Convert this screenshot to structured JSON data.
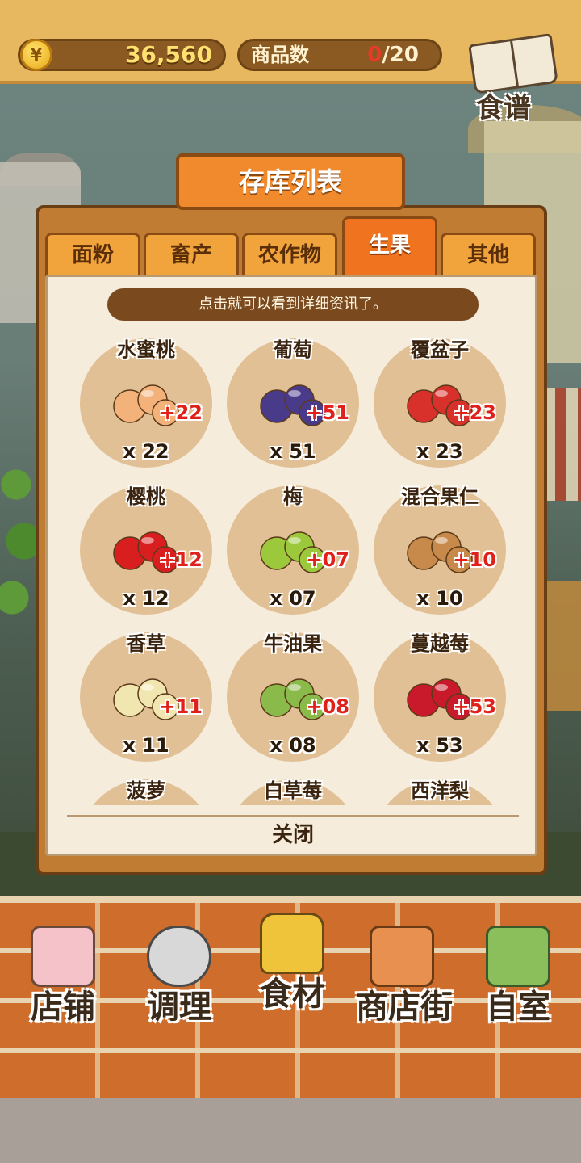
{
  "topbar": {
    "money": "36,560",
    "coin_symbol": "¥",
    "goods_label": "商品数",
    "goods_current": "0",
    "goods_max": "/20",
    "recipe_label": "食谱"
  },
  "dialog": {
    "title": "存库列表",
    "hint": "点击就可以看到详细资讯了。",
    "close_label": "关闭",
    "tabs": [
      {
        "label": "面粉",
        "active": false
      },
      {
        "label": "畜产",
        "active": false
      },
      {
        "label": "农作物",
        "active": false
      },
      {
        "label": "生果",
        "active": true
      },
      {
        "label": "其他",
        "active": false
      }
    ],
    "items": [
      {
        "name": "水蜜桃",
        "plus": "+22",
        "qty": "x 22",
        "icon": "peach-icon",
        "color": "#f3b27a"
      },
      {
        "name": "葡萄",
        "plus": "+51",
        "qty": "x 51",
        "icon": "grape-icon",
        "color": "#4a3a8a"
      },
      {
        "name": "覆盆子",
        "plus": "+23",
        "qty": "x 23",
        "icon": "raspberry-icon",
        "color": "#d8302a"
      },
      {
        "name": "樱桃",
        "plus": "+12",
        "qty": "x 12",
        "icon": "cherry-icon",
        "color": "#d81e1e"
      },
      {
        "name": "梅",
        "plus": "+07",
        "qty": "x 07",
        "icon": "plum-icon",
        "color": "#9cc83c"
      },
      {
        "name": "混合果仁",
        "plus": "+10",
        "qty": "x 10",
        "icon": "nuts-icon",
        "color": "#c88a4a"
      },
      {
        "name": "香草",
        "plus": "+11",
        "qty": "x 11",
        "icon": "vanilla-icon",
        "color": "#f2e6b0"
      },
      {
        "name": "牛油果",
        "plus": "+08",
        "qty": "x 08",
        "icon": "avocado-icon",
        "color": "#8aba4a"
      },
      {
        "name": "蔓越莓",
        "plus": "+53",
        "qty": "x 53",
        "icon": "cranberry-icon",
        "color": "#c81a2a"
      },
      {
        "name": "菠萝",
        "plus": "",
        "qty": "",
        "icon": "pineapple-icon",
        "color": "#e8c040"
      },
      {
        "name": "白草莓",
        "plus": "",
        "qty": "",
        "icon": "white-strawberry-icon",
        "color": "#f4ece0"
      },
      {
        "name": "西洋梨",
        "plus": "",
        "qty": "",
        "icon": "pear-icon",
        "color": "#b8c860"
      }
    ]
  },
  "nav": [
    {
      "label": "店铺",
      "icon": "shop-cake-icon"
    },
    {
      "label": "调理",
      "icon": "cooking-bowl-icon"
    },
    {
      "label": "食材",
      "icon": "ingredient-bag-icon"
    },
    {
      "label": "商店街",
      "icon": "street-shop-icon"
    },
    {
      "label": "自室",
      "icon": "staff-only-door-icon"
    }
  ]
}
